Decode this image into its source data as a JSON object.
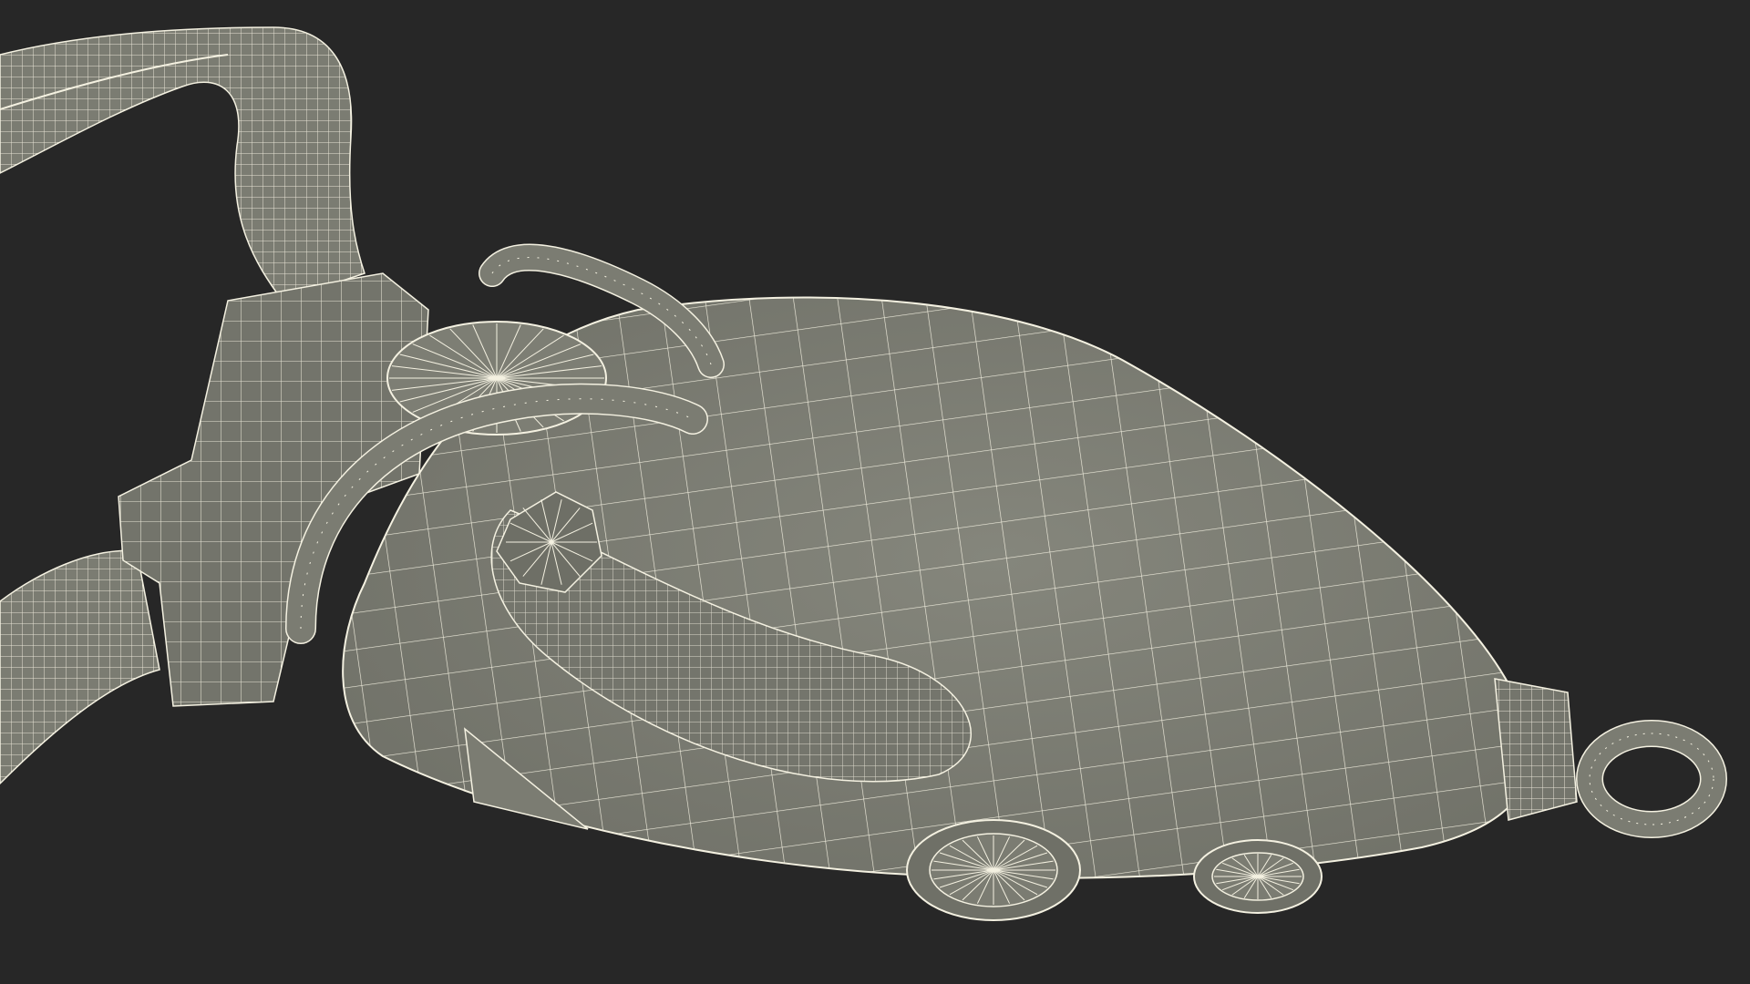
{
  "scene": {
    "subject": "",
    "background_color": "#272727",
    "surface_color": "#7b7c72",
    "shadow_color": "#5f6058",
    "wire_color": "#f4f1e1",
    "icon": "wireframe-model-icon"
  }
}
